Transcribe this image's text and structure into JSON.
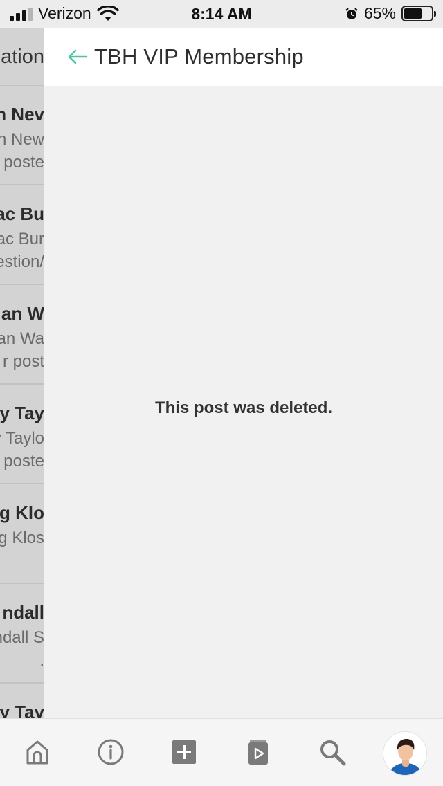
{
  "status_bar": {
    "carrier": "Verizon",
    "time": "8:14 AM",
    "battery": "65%",
    "battery_level": 0.65,
    "icons": [
      "signal-icon",
      "wifi-icon",
      "alarm-icon",
      "battery-icon"
    ]
  },
  "background_list": {
    "header_fragment": "ation",
    "items": [
      {
        "line1": "n Nev",
        "line2": "n New",
        "line3": " poste"
      },
      {
        "line1": "ac Bu",
        "line2": "ac Bur",
        "line3": "estion/"
      },
      {
        "line1": "an W",
        "line2": "an Wa",
        "line3": "r post"
      },
      {
        "line1": "y Tay",
        "line2": "y Taylo",
        "line3": " poste"
      },
      {
        "line1": "eg Klo",
        "line2": "g Klos",
        "line3": ""
      },
      {
        "line1": "ndall ",
        "line2": "ndall S",
        "line3": "."
      },
      {
        "line1": "y Tay",
        "line2": "",
        "line3": ""
      }
    ]
  },
  "detail": {
    "title": "TBH VIP Membership",
    "message": "This post was deleted.",
    "back_icon": "arrow-left-icon",
    "accent": "#4fc3a1",
    "background": "#f1f1f1"
  },
  "tab_bar": {
    "tabs": [
      {
        "id": "home",
        "icon": "home-icon"
      },
      {
        "id": "info",
        "icon": "info-icon"
      },
      {
        "id": "create",
        "icon": "plus-square-icon"
      },
      {
        "id": "library",
        "icon": "video-book-icon"
      },
      {
        "id": "search",
        "icon": "search-icon"
      },
      {
        "id": "profile",
        "icon": "avatar"
      }
    ]
  }
}
